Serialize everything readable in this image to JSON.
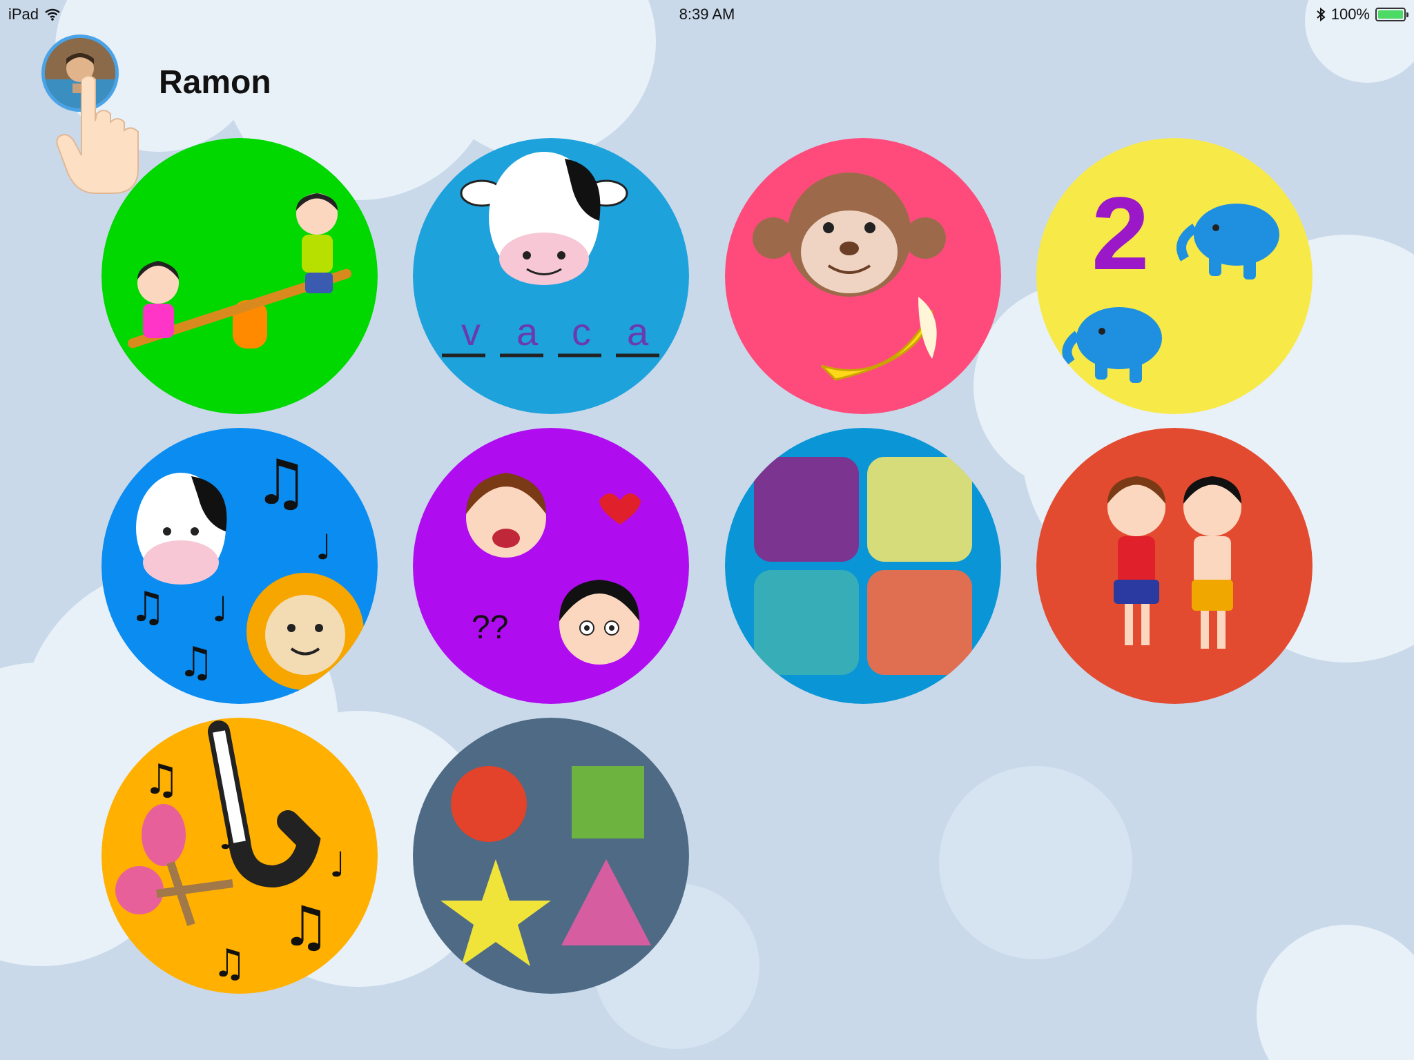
{
  "status_bar": {
    "device": "iPad",
    "time": "8:39 AM",
    "battery": "100%",
    "battery_level": 1.0,
    "icons": [
      "wifi-icon",
      "bluetooth-icon",
      "battery-icon"
    ]
  },
  "profile": {
    "name": "Ramon",
    "avatar_icon": "user-avatar"
  },
  "activities": [
    {
      "id": "playground",
      "color": "#00d800",
      "icon": "seesaw-kids-icon"
    },
    {
      "id": "words",
      "color": "#1ea2dc",
      "icon": "cow-word-icon",
      "letters": [
        "v",
        "a",
        "c",
        "a"
      ]
    },
    {
      "id": "monkey",
      "color": "#fe4b7b",
      "icon": "monkey-banana-icon"
    },
    {
      "id": "numbers",
      "color": "#f7ea48",
      "icon": "number-elephants-icon",
      "number": "2"
    },
    {
      "id": "animal-sounds",
      "color": "#0a8cf0",
      "icon": "animal-music-icon"
    },
    {
      "id": "emotions",
      "color": "#b00cf0",
      "icon": "emotion-faces-icon",
      "marks": "??"
    },
    {
      "id": "colors",
      "color": "#0a96d6",
      "icon": "color-squares-icon",
      "swatches": [
        "#7b3590",
        "#d6dc7a",
        "#37adb8",
        "#e06f52"
      ]
    },
    {
      "id": "body",
      "color": "#e34b30",
      "icon": "body-kids-icon"
    },
    {
      "id": "instruments",
      "color": "#ffb000",
      "icon": "music-instruments-icon"
    },
    {
      "id": "shapes",
      "color": "#4e6a85",
      "icon": "shapes-icon"
    }
  ]
}
